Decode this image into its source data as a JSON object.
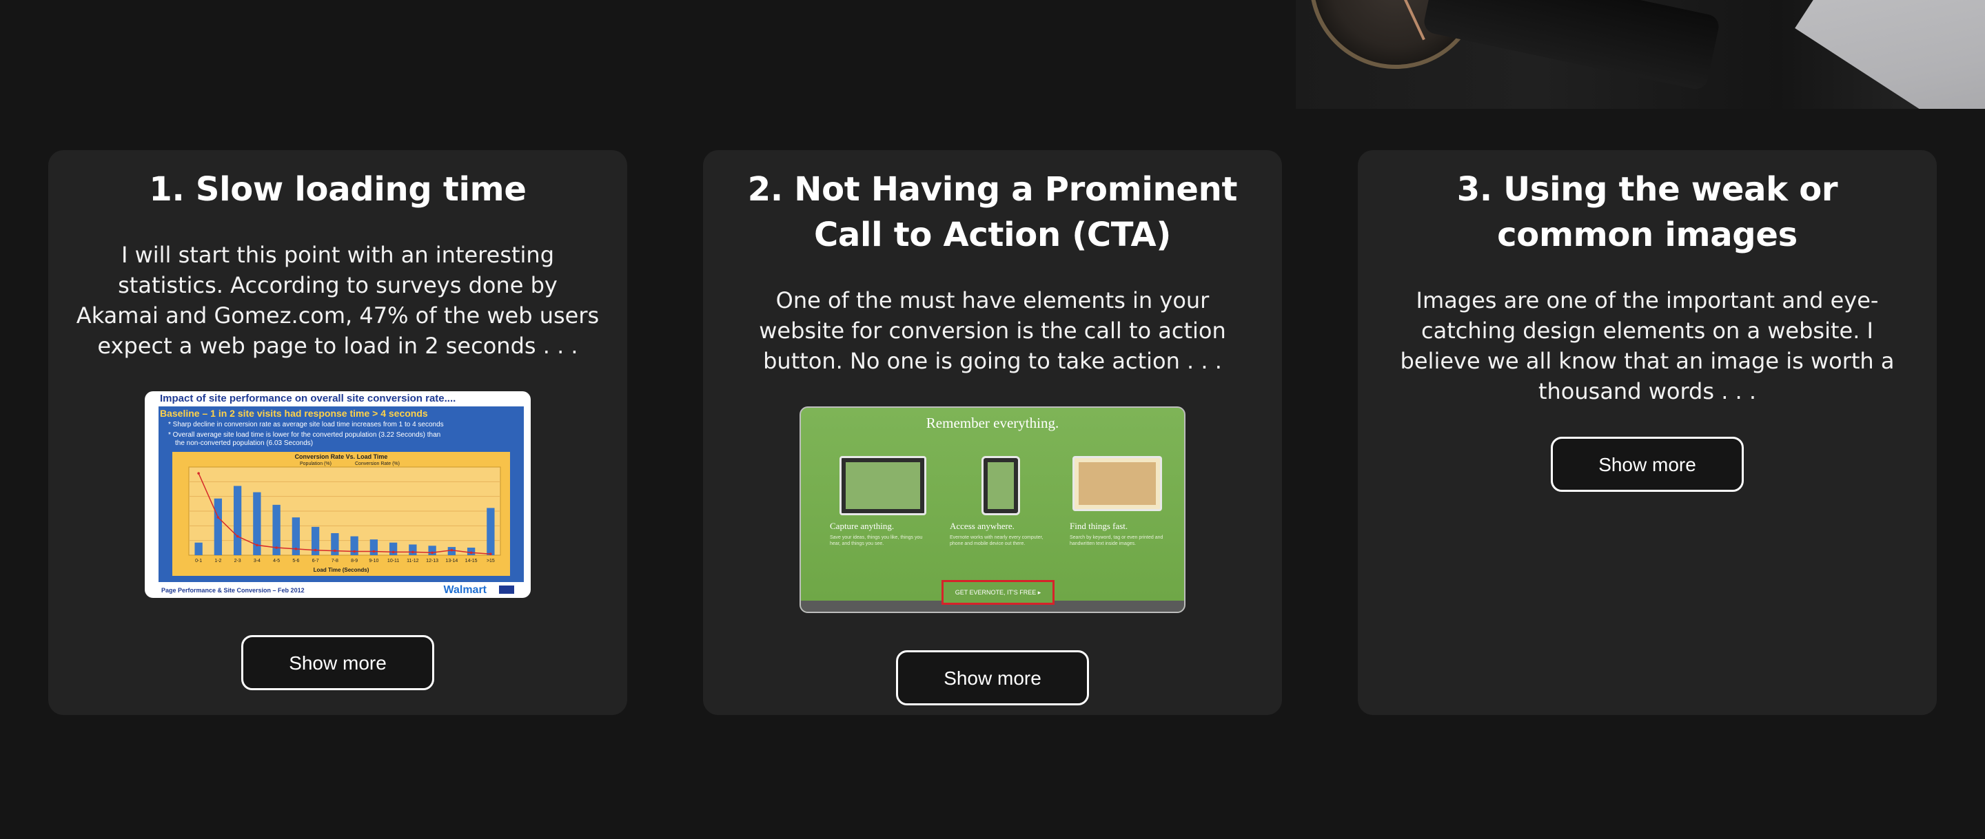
{
  "cards": [
    {
      "title": "1. Slow loading time",
      "description": "I will start this point with an interesting statistics. According to surveys done by Akamai and Gomez.com, 47% of the web users expect a web page to load in 2 seconds . . .",
      "button_label": "Show more",
      "thumbnail": {
        "title": "Impact of site performance on overall site conversion rate....",
        "headline": "Baseline – 1 in 2 site visits had response time > 4 seconds",
        "bullet_1": "* Sharp decline in conversion rate as average site load time increases from 1 to 4 seconds",
        "bullet_2": "* Overall average site load time is lower for the converted population (3.22 Seconds) than",
        "bullet_2b": "the non-converted population (6.03 Seconds)",
        "chart_title": "Conversion Rate Vs. Load Time",
        "legend_1": "Population (%)",
        "legend_2": "Conversion Rate (%)",
        "x_axis_label": "Load Time (Seconds)",
        "footer_left": "Page Performance & Site Conversion – Feb 2012",
        "footer_brand": "Walmart",
        "chart_data": {
          "type": "bar",
          "categories": [
            "0-1",
            "1-2",
            "2-3",
            "3-4",
            "4-5",
            "5-6",
            "6-7",
            "7-8",
            "8-9",
            "9-10",
            "10-11",
            "11-12",
            "12-13",
            "13-14",
            "14-15",
            ">15"
          ],
          "series": [
            {
              "name": "Population (%)",
              "values": [
                2,
                9,
                11,
                10,
                8,
                6,
                4.5,
                3.5,
                3,
                2.5,
                2,
                1.7,
                1.5,
                1.3,
                1.2,
                7.5
              ]
            },
            {
              "name": "Conversion Rate (%)",
              "values": [
                13,
                6,
                3,
                1.6,
                1.2,
                1,
                0.8,
                0.7,
                0.6,
                0.6,
                0.5,
                0.5,
                0.4,
                0.8,
                0.4,
                0.2
              ]
            }
          ],
          "colors": {
            "bars": "#3a78c8",
            "line": "#d62a2a",
            "plot_bg": "#f7c24a",
            "frame_bg": "#2f63b8"
          }
        }
      }
    },
    {
      "title": "2. Not Having a Prominent Call to Action (CTA)",
      "description": "One of the must have elements in your website for conversion is the call to action button. No one is going to take action . . .",
      "button_label": "Show more",
      "thumbnail": {
        "heading": "Remember everything.",
        "col_1_title": "Capture anything.",
        "col_1_text": "Save your ideas, things you like, things you hear, and things you see.",
        "col_2_title": "Access anywhere.",
        "col_2_text": "Evernote works with nearly every computer, phone and mobile device out there.",
        "col_3_title": "Find things fast.",
        "col_3_text": "Search by keyword, tag or even printed and handwritten text inside images.",
        "cta_label": "GET EVERNOTE, IT'S FREE ▸"
      }
    },
    {
      "title": "3. Using the weak or common images",
      "description": "Images are one of the important and eye-catching design elements on a website. I believe we all know that an image is worth a thousand words . . .",
      "button_label": "Show more"
    }
  ],
  "colors": {
    "page_background": "#151515",
    "card_background": "#232323",
    "text": "#ffffff",
    "button_border": "#ffffff"
  }
}
